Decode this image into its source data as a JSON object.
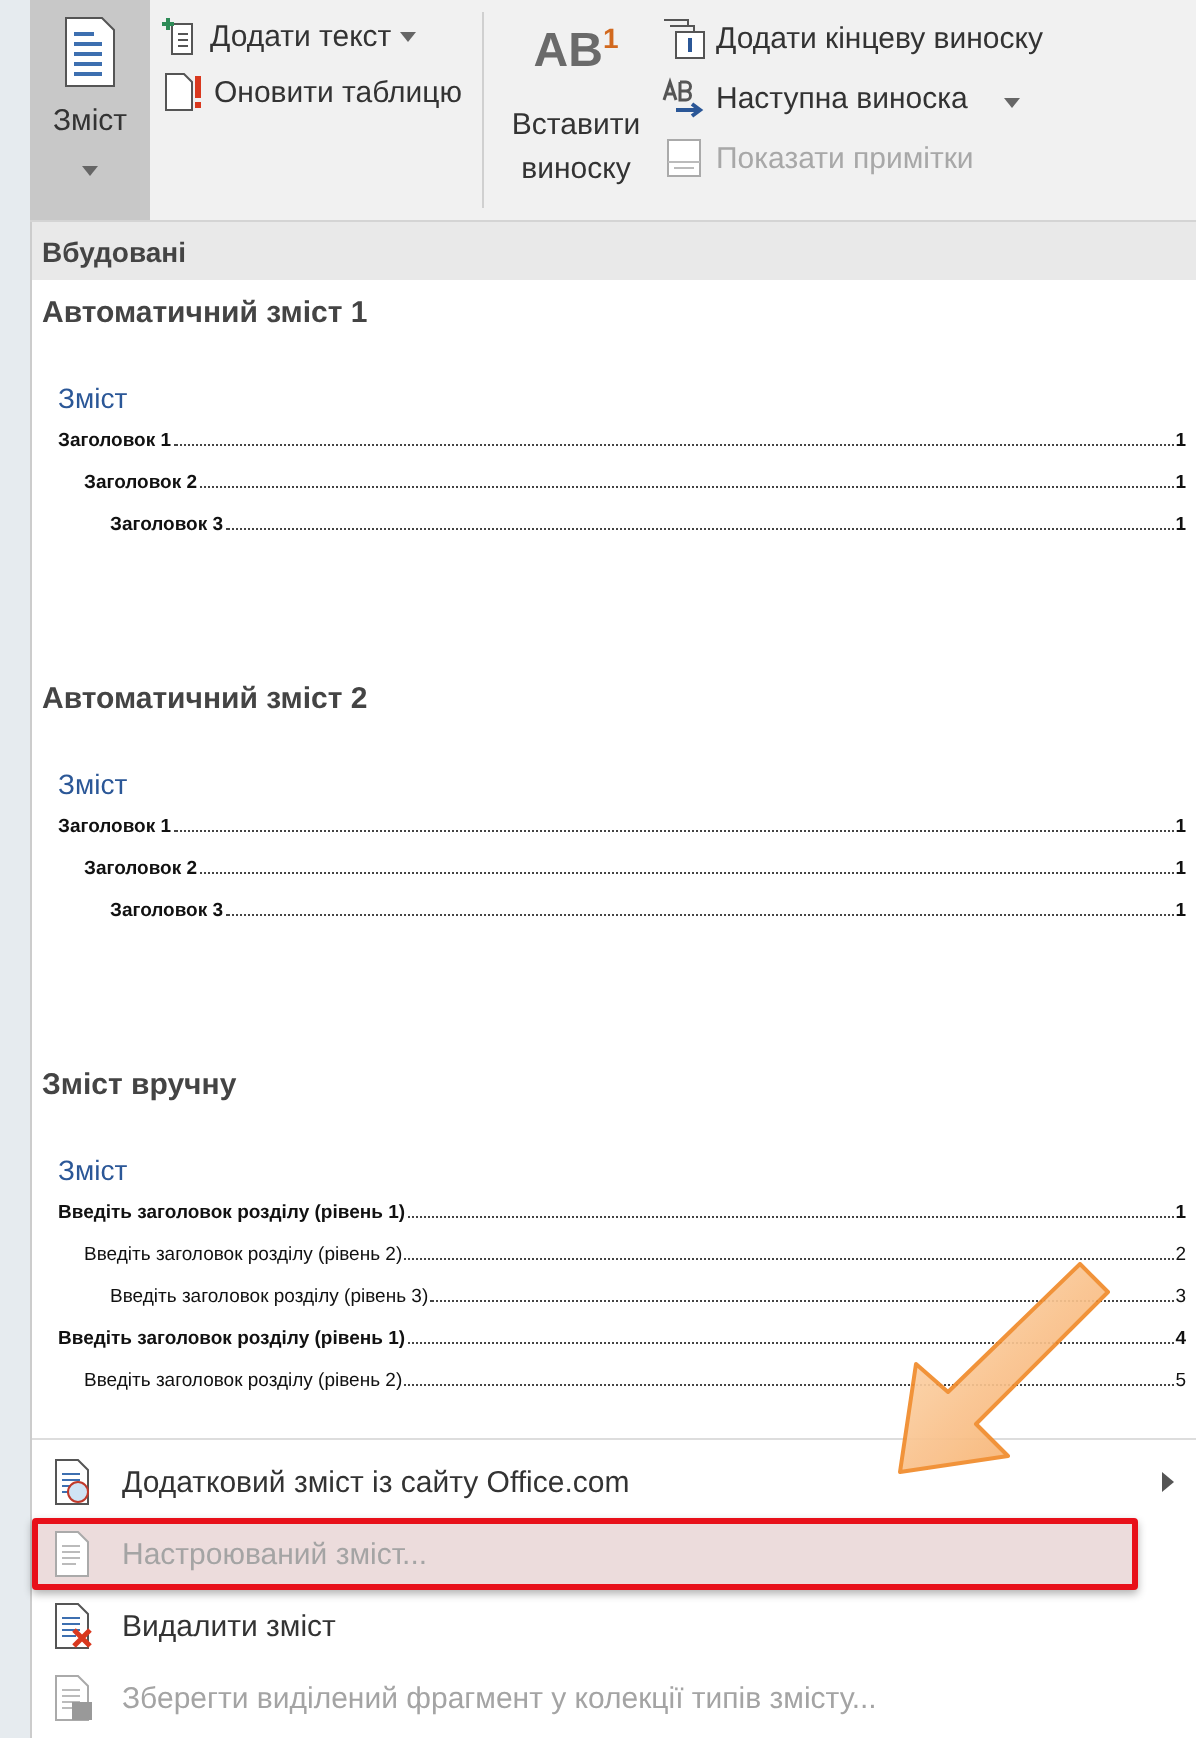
{
  "ribbon": {
    "toc_button": {
      "label": "Зміст",
      "selected": true
    },
    "add_text": {
      "label": "Додати текст",
      "dropdown": true
    },
    "update_table": {
      "label": "Оновити таблицю"
    },
    "insert_footnote": {
      "icon_label": "AB$^{1}$",
      "label": "Вставити виноску"
    },
    "commands": [
      {
        "kind": "endnote",
        "label": "Додати кінцеву виноску",
        "disabled": false,
        "dropdown": false
      },
      {
        "kind": "next",
        "label": "Наступна виноска",
        "disabled": false,
        "dropdown": true
      },
      {
        "kind": "notes",
        "label": "Показати примітки",
        "disabled": true,
        "dropdown": false
      }
    ]
  },
  "menu": {
    "section_header": "Вбудовані",
    "galleries": [
      {
        "title": "Автоматичний зміст 1",
        "preview_heading": "Зміст",
        "entries": [
          {
            "text": "Заголовок 1",
            "page": "1",
            "bold": true,
            "children": [
              {
                "text": "Заголовок 2",
                "page": "1",
                "bold": true,
                "children": [
                  {
                    "text": "Заголовок 3",
                    "page": "1",
                    "bold": true
                  }
                ]
              }
            ]
          }
        ]
      },
      {
        "title": "Автоматичний зміст 2",
        "preview_heading": "Зміст",
        "entries": [
          {
            "text": "Заголовок 1",
            "page": "1",
            "bold": true,
            "children": [
              {
                "text": "Заголовок 2",
                "page": "1",
                "bold": true,
                "children": [
                  {
                    "text": "Заголовок 3",
                    "page": "1",
                    "bold": true
                  }
                ]
              }
            ]
          }
        ]
      },
      {
        "title": "Зміст вручну",
        "preview_heading": "Зміст",
        "entries": [
          {
            "text": "Введіть заголовок розділу (рівень 1)",
            "page": "1",
            "bold": true,
            "children": [
              {
                "text": "Введіть заголовок розділу (рівень 2)",
                "page": "2",
                "bold": false,
                "children": [
                  {
                    "text": "Введіть заголовок розділу (рівень 3)",
                    "page": "3",
                    "bold": false
                  }
                ]
              }
            ]
          },
          {
            "text": "Введіть заголовок розділу (рівень 1)",
            "page": "4",
            "bold": true,
            "children": [
              {
                "text": "Введіть заголовок розділу (рівень 2)",
                "page": "5",
                "bold": false
              }
            ]
          }
        ]
      }
    ],
    "items": [
      {
        "kind": "web",
        "label": "Додатковий зміст із сайту Office.com",
        "disabled": false,
        "submenu": true,
        "highlighted": false
      },
      {
        "kind": "custom",
        "label": "Настроюваний зміст...",
        "disabled": true,
        "submenu": false,
        "highlighted": true
      },
      {
        "kind": "remove",
        "label": "Видалити зміст",
        "disabled": false,
        "submenu": false,
        "highlighted": false
      },
      {
        "kind": "save",
        "label": "Зберегти виділений фрагмент у колекції типів змісту...",
        "disabled": true,
        "submenu": false,
        "highlighted": false
      }
    ]
  },
  "annotation": {
    "arrow": true
  }
}
